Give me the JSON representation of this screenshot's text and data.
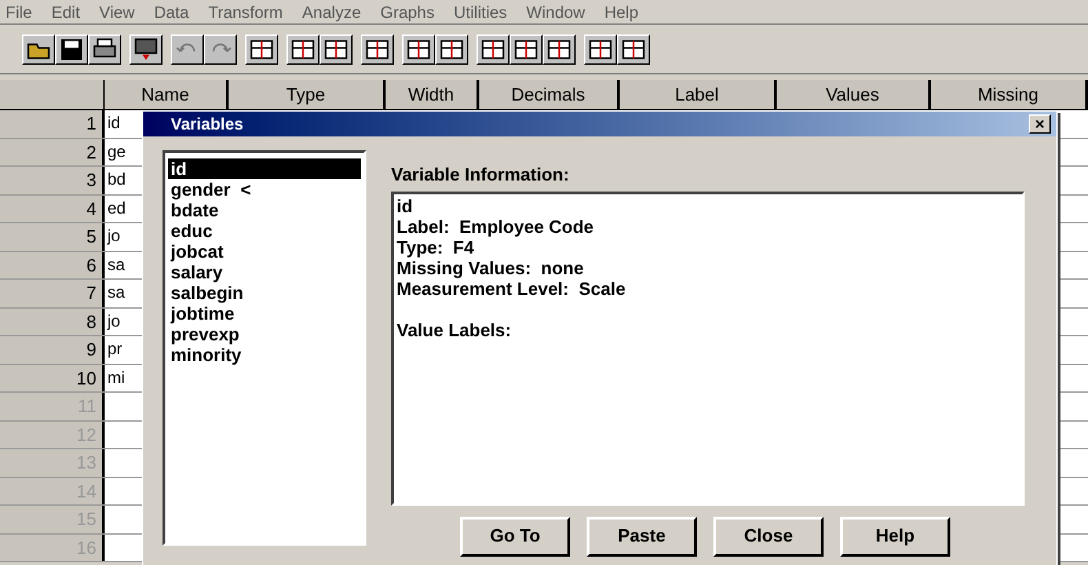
{
  "menu": [
    "File",
    "Edit",
    "View",
    "Data",
    "Transform",
    "Analyze",
    "Graphs",
    "Utilities",
    "Window",
    "Help"
  ],
  "grid": {
    "columns": [
      "Name",
      "Type",
      "Width",
      "Decimals",
      "Label",
      "Values",
      "Missing"
    ],
    "rows": [
      {
        "number": "1",
        "name": "id"
      },
      {
        "number": "2",
        "name": "ge"
      },
      {
        "number": "3",
        "name": "bd"
      },
      {
        "number": "4",
        "name": "ed"
      },
      {
        "number": "5",
        "name": "jo"
      },
      {
        "number": "6",
        "name": "sa"
      },
      {
        "number": "7",
        "name": "sa"
      },
      {
        "number": "8",
        "name": "jo"
      },
      {
        "number": "9",
        "name": "pr"
      },
      {
        "number": "10",
        "name": "mi"
      },
      {
        "number": "11"
      },
      {
        "number": "12"
      },
      {
        "number": "13"
      },
      {
        "number": "14"
      },
      {
        "number": "15"
      },
      {
        "number": "16"
      }
    ]
  },
  "dialog": {
    "title": "Variables",
    "close": "×",
    "variables": [
      {
        "name": "id",
        "selected": true
      },
      {
        "name": "gender  <",
        "selected": false
      },
      {
        "name": "bdate",
        "selected": false
      },
      {
        "name": "educ",
        "selected": false
      },
      {
        "name": "jobcat",
        "selected": false
      },
      {
        "name": "salary",
        "selected": false
      },
      {
        "name": "salbegin",
        "selected": false
      },
      {
        "name": "jobtime",
        "selected": false
      },
      {
        "name": "prevexp",
        "selected": false
      },
      {
        "name": "minority",
        "selected": false
      }
    ],
    "info_heading": "Variable Information:",
    "info_lines": [
      "id",
      "Label:  Employee Code",
      "Type:  F4",
      "Missing Values:  none",
      "Measurement Level:  Scale"
    ],
    "value_labels_heading": "Value Labels:",
    "buttons": [
      "Go To",
      "Paste",
      "Close",
      "Help"
    ]
  }
}
